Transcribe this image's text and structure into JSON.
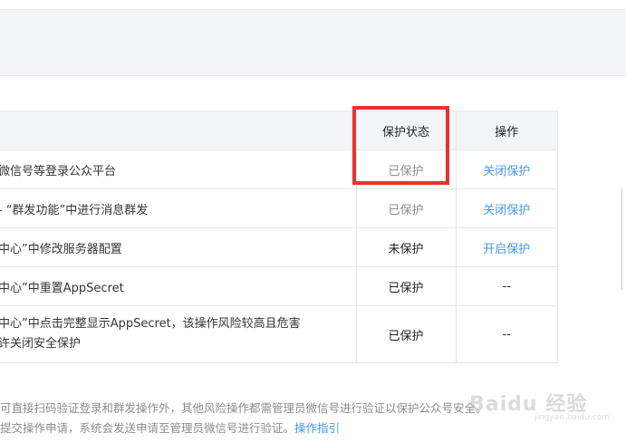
{
  "table": {
    "headers": {
      "status": "保护状态",
      "operation": "操作"
    },
    "rows": [
      {
        "desc": "微信号等登录公众平台",
        "status": "已保护",
        "action": "关闭保护"
      },
      {
        "desc": "- “群发功能”中进行消息群发",
        "status": "已保护",
        "action": "关闭保护"
      },
      {
        "desc": "中心”中修改服务器配置",
        "status": "未保护",
        "action": "开启保护"
      },
      {
        "desc": "中心”中重置AppSecret",
        "status": "已保护",
        "action": "--"
      },
      {
        "desc_line1": "中心”中点击完整显示AppSecret，该操作风险较高且危害",
        "desc_line2": "许关闭安全保护",
        "status": "已保护",
        "action": "--"
      }
    ]
  },
  "notes": {
    "line1": "可直接扫码验证登录和群发操作外，其他风险操作都需管理员微信号进行验证以保护公众号安全。",
    "line2_text": "提交操作申请，系统会发送申请至管理员微信号进行验证。",
    "line2_link": "操作指引"
  },
  "watermark": {
    "main": "Baidu 经验",
    "sub": "jingyan.baidu.com"
  },
  "colors": {
    "link": "#459ae9",
    "highlight": "#e8322f",
    "header_bg": "#f4f5f9"
  }
}
